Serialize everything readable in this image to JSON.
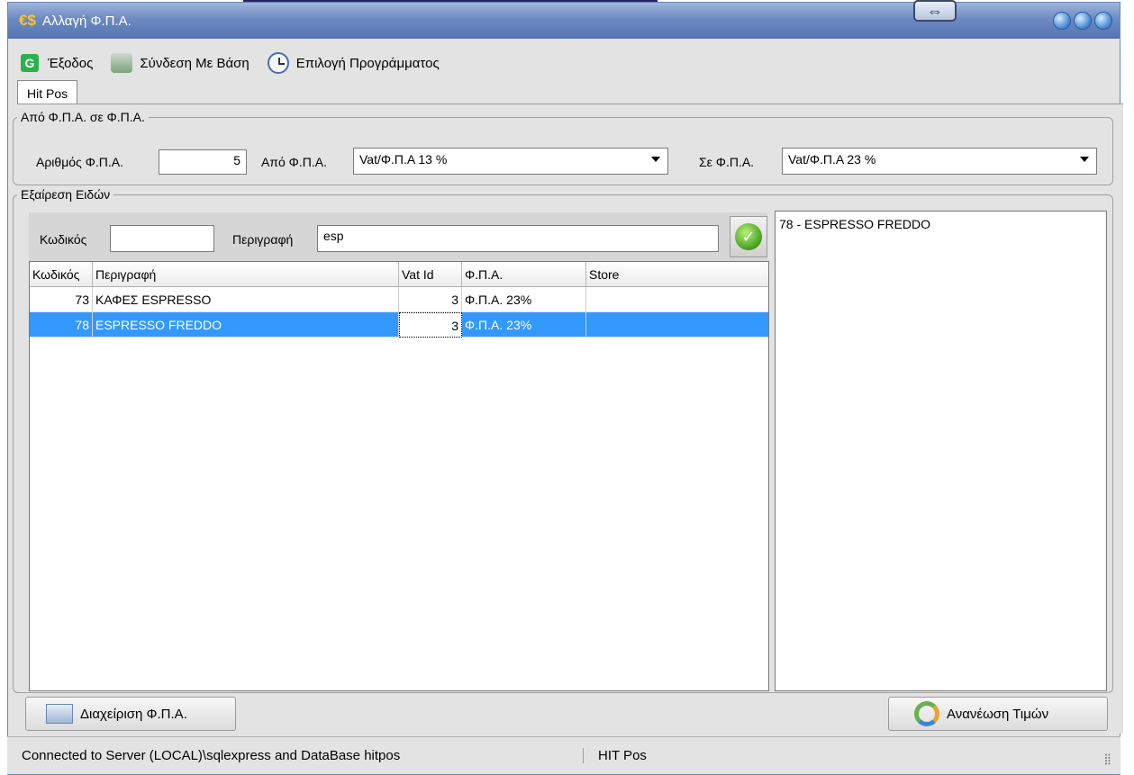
{
  "window": {
    "title": "Αλλαγή Φ.Π.Α."
  },
  "menu": [
    {
      "label": "Έξοδος",
      "icon": "exit-icon"
    },
    {
      "label": "Σύνδεση Με Βάση",
      "icon": "database-icon"
    },
    {
      "label": "Επιλογή Προγράμματος",
      "icon": "clock-icon"
    }
  ],
  "tab": {
    "label": "Hit Pos"
  },
  "vat_group": {
    "legend": "Από Φ.Π.Α. σε Φ.Π.Α.",
    "number_label": "Αριθμός Φ.Π.Α.",
    "number_value": "5",
    "from_label": "Από Φ.Π.Α.",
    "from_value": "Vat/Φ.Π.Α 13 %",
    "to_label": "Σε Φ.Π.Α.",
    "to_value": "Vat/Φ.Π.Α 23 %"
  },
  "exclude_group": {
    "legend": "Εξαίρεση Ειδών",
    "code_label": "Κωδικός",
    "code_value": "",
    "desc_label": "Περιγραφή",
    "desc_value": "esp"
  },
  "grid": {
    "columns": [
      "Κωδικός",
      "Περιγραφή",
      "Vat Id",
      "Φ.Π.Α.",
      "Store"
    ],
    "rows": [
      {
        "code": "73",
        "desc": "ΚΑΦΕΣ ESPRESSO",
        "vat_id": "3",
        "vat": "Φ.Π.Α. 23%",
        "store": ""
      },
      {
        "code": "78",
        "desc": "ESPRESSO FREDDO",
        "vat_id": "3",
        "vat": "Φ.Π.Α. 23%",
        "store": "",
        "selected": true
      }
    ]
  },
  "excluded_list": [
    "78 - ESPRESSO FREDDO"
  ],
  "buttons": {
    "vat_manage": "Διαχείριση Φ.Π.Α.",
    "refresh_prices": "Ανανέωση Τιμών"
  },
  "status": {
    "connection": "Connected to Server (LOCAL)\\sqlexpress and DataBase hitpos",
    "app": "HIT Pos"
  },
  "colors": {
    "titlebar": "#6c8ac2",
    "selection": "#3399ff"
  }
}
